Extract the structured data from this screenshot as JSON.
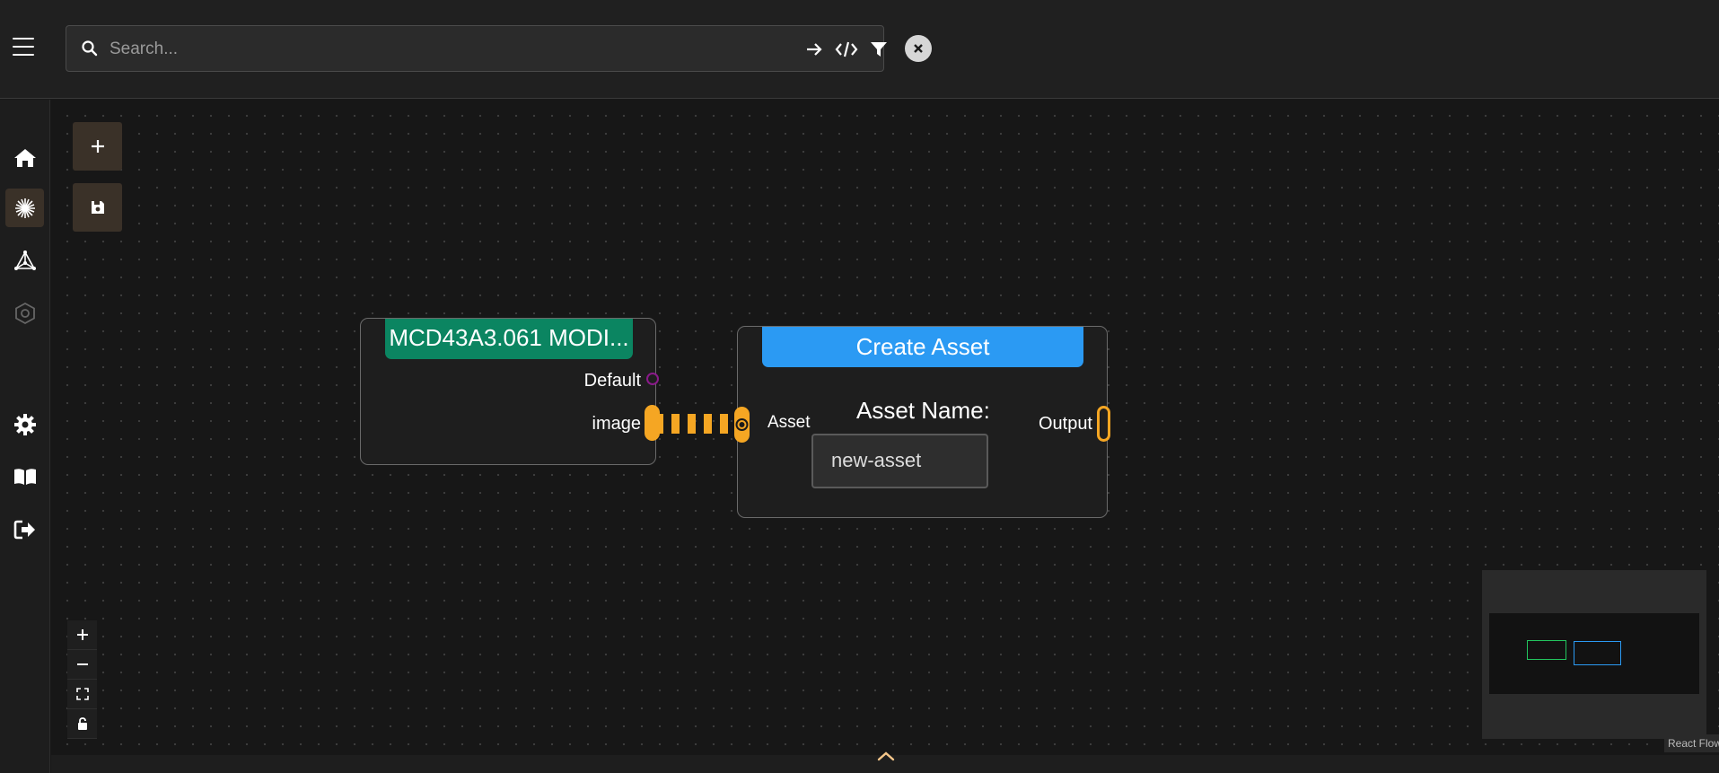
{
  "search": {
    "placeholder": "Search..."
  },
  "toolbar": {
    "buttons": [
      "arrow-right-icon",
      "code-icon",
      "filter-icon"
    ],
    "close": "close-icon"
  },
  "sidebar": {
    "items": [
      "home-icon",
      "starburst-icon",
      "network-icon",
      "hexagon-icon",
      "gear-icon",
      "book-icon",
      "logout-icon"
    ],
    "active": "starburst-icon"
  },
  "canvas_tools": {
    "add": "plus-icon",
    "save": "save-icon"
  },
  "nodes": {
    "source": {
      "title": "MCD43A3.061 MODI...",
      "outputs": [
        "Default",
        "image"
      ]
    },
    "create_asset": {
      "title": "Create Asset",
      "input_label": "Asset",
      "field_label": "Asset Name:",
      "field_value": "new-asset",
      "output_label": "Output"
    }
  },
  "zoom_controls": [
    "zoom-in-icon",
    "zoom-out-icon",
    "fit-view-icon",
    "lock-icon"
  ],
  "attribution": "React Flow",
  "colors": {
    "accent": "#f5a623",
    "green_header": "#0b8561",
    "blue_header": "#2b9af3",
    "active_bg": "#3a3128"
  }
}
